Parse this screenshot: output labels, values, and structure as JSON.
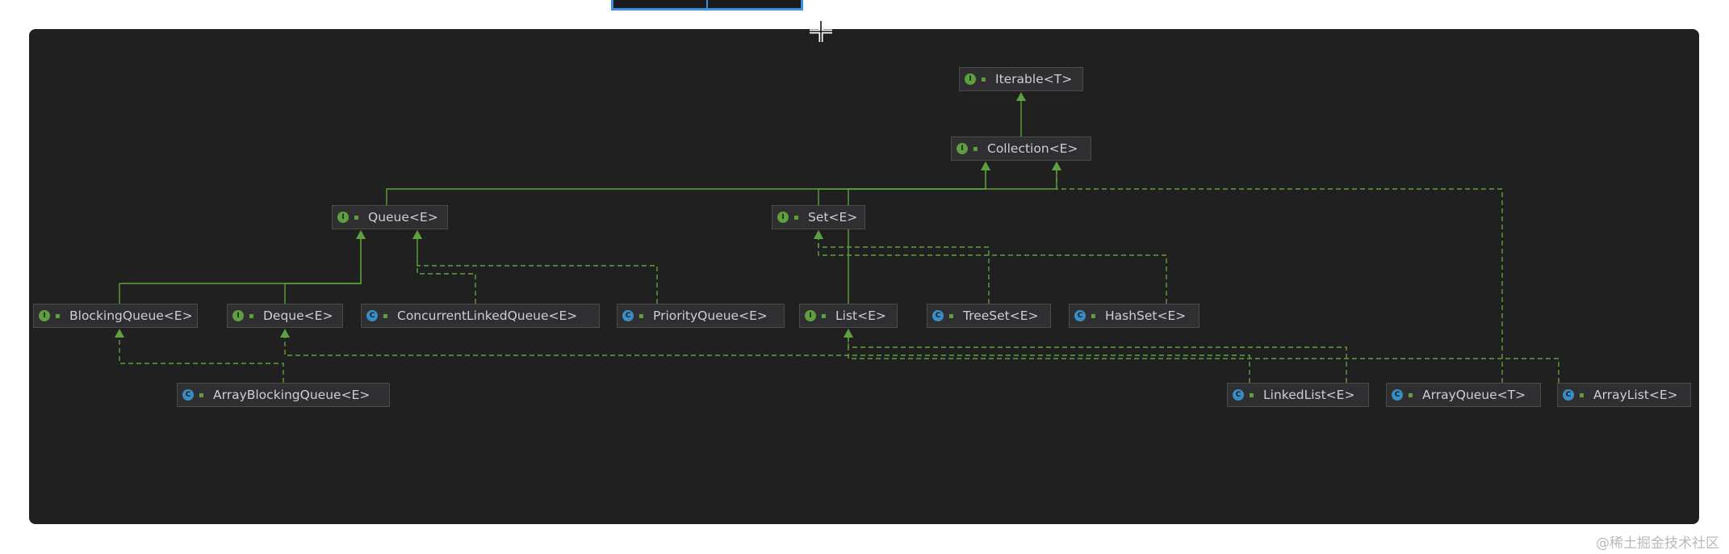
{
  "diagram": {
    "nodes": [
      {
        "id": "iterable",
        "label": "Iterable<T>",
        "kind": "interface",
        "kind_icon": "I",
        "visibility_icon": "public-icon"
      },
      {
        "id": "collection",
        "label": "Collection<E>",
        "kind": "interface",
        "kind_icon": "I",
        "visibility_icon": "public-icon"
      },
      {
        "id": "queue",
        "label": "Queue<E>",
        "kind": "interface",
        "kind_icon": "I",
        "visibility_icon": "public-icon"
      },
      {
        "id": "set",
        "label": "Set<E>",
        "kind": "interface",
        "kind_icon": "I",
        "visibility_icon": "public-icon"
      },
      {
        "id": "blockingqueue",
        "label": "BlockingQueue<E>",
        "kind": "interface",
        "kind_icon": "I",
        "visibility_icon": "public-icon"
      },
      {
        "id": "deque",
        "label": "Deque<E>",
        "kind": "interface",
        "kind_icon": "I",
        "visibility_icon": "public-icon"
      },
      {
        "id": "concurrentlinkedqueue",
        "label": "ConcurrentLinkedQueue<E>",
        "kind": "class",
        "kind_icon": "C",
        "visibility_icon": "public-icon"
      },
      {
        "id": "priorityqueue",
        "label": "PriorityQueue<E>",
        "kind": "class",
        "kind_icon": "C",
        "visibility_icon": "public-icon"
      },
      {
        "id": "list",
        "label": "List<E>",
        "kind": "interface",
        "kind_icon": "I",
        "visibility_icon": "public-icon"
      },
      {
        "id": "treeset",
        "label": "TreeSet<E>",
        "kind": "class",
        "kind_icon": "C",
        "visibility_icon": "public-icon"
      },
      {
        "id": "hashset",
        "label": "HashSet<E>",
        "kind": "class",
        "kind_icon": "C",
        "visibility_icon": "public-icon"
      },
      {
        "id": "arrayblockingqueue",
        "label": "ArrayBlockingQueue<E>",
        "kind": "class",
        "kind_icon": "C",
        "visibility_icon": "public-icon"
      },
      {
        "id": "linkedlist",
        "label": "LinkedList<E>",
        "kind": "class",
        "kind_icon": "C",
        "visibility_icon": "public-icon"
      },
      {
        "id": "arrayqueue",
        "label": "ArrayQueue<T>",
        "kind": "class",
        "kind_icon": "C",
        "visibility_icon": "public-icon"
      },
      {
        "id": "arraylist",
        "label": "ArrayList<E>",
        "kind": "class",
        "kind_icon": "C",
        "visibility_icon": "public-icon"
      }
    ],
    "edges": [
      {
        "from": "collection",
        "to": "iterable",
        "type": "extends"
      },
      {
        "from": "queue",
        "to": "collection",
        "type": "extends"
      },
      {
        "from": "set",
        "to": "collection",
        "type": "extends"
      },
      {
        "from": "list",
        "to": "collection",
        "type": "extends"
      },
      {
        "from": "blockingqueue",
        "to": "queue",
        "type": "extends"
      },
      {
        "from": "deque",
        "to": "queue",
        "type": "extends"
      },
      {
        "from": "concurrentlinkedqueue",
        "to": "queue",
        "type": "implements"
      },
      {
        "from": "priorityqueue",
        "to": "queue",
        "type": "implements"
      },
      {
        "from": "treeset",
        "to": "set",
        "type": "implements"
      },
      {
        "from": "hashset",
        "to": "set",
        "type": "implements"
      },
      {
        "from": "arrayblockingqueue",
        "to": "blockingqueue",
        "type": "implements"
      },
      {
        "from": "linkedlist",
        "to": "deque",
        "type": "implements"
      },
      {
        "from": "linkedlist",
        "to": "list",
        "type": "implements"
      },
      {
        "from": "arraylist",
        "to": "list",
        "type": "implements"
      },
      {
        "from": "arrayqueue",
        "to": "collection",
        "type": "implements"
      }
    ],
    "colors": {
      "background": "#202020",
      "node_fill": "#2f2f31",
      "node_border": "#4b4b4e",
      "node_text": "#cfcfd2",
      "edge": "#5e9f3e",
      "interface_badge": "#5e9f3e",
      "class_badge": "#3a8dc4"
    }
  },
  "watermark": "@稀土掘金技术社区"
}
